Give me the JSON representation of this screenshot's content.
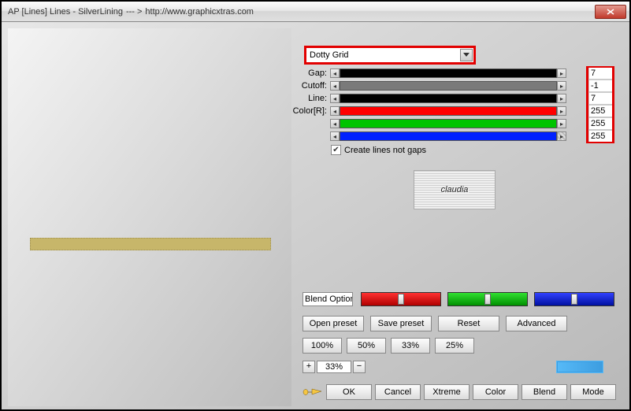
{
  "window": {
    "title_app": "AP [Lines]  Lines - SilverLining",
    "title_arrow": "--- >",
    "title_url": "http://www.graphicxtras.com"
  },
  "dropdown": {
    "selected": "Dotty Grid"
  },
  "sliders": {
    "gap": {
      "label": "Gap:",
      "value": "7",
      "fill": "#000000"
    },
    "cutoff": {
      "label": "Cutoff:",
      "value": "-1",
      "fill": "#7a7a7a"
    },
    "line": {
      "label": "Line:",
      "value": "7",
      "fill": "#000000"
    },
    "r": {
      "label": "Color[R]:",
      "value": "255",
      "fill": "#ff0000"
    },
    "g": {
      "label": "",
      "value": "255",
      "fill": "#00c400"
    },
    "b": {
      "label": "",
      "value": "255",
      "fill": "#0020ff"
    }
  },
  "checkbox": {
    "label": "Create lines not gaps",
    "checked": true
  },
  "logo_text": "claudia",
  "blend_mode": {
    "label": "Blend Options"
  },
  "rgb_big": {
    "r": "#e20000",
    "g": "#00c400",
    "b": "#0020ff"
  },
  "buttons": {
    "open_preset": "Open preset",
    "save_preset": "Save preset",
    "reset": "Reset",
    "advanced": "Advanced",
    "pct100": "100%",
    "pct50": "50%",
    "pct33": "33%",
    "pct25": "25%",
    "zoom_plus": "+",
    "zoom_val": "33%",
    "zoom_minus": "−",
    "ok": "OK",
    "cancel": "Cancel",
    "xtreme": "Xtreme",
    "color": "Color",
    "blend": "Blend",
    "mode": "Mode"
  }
}
